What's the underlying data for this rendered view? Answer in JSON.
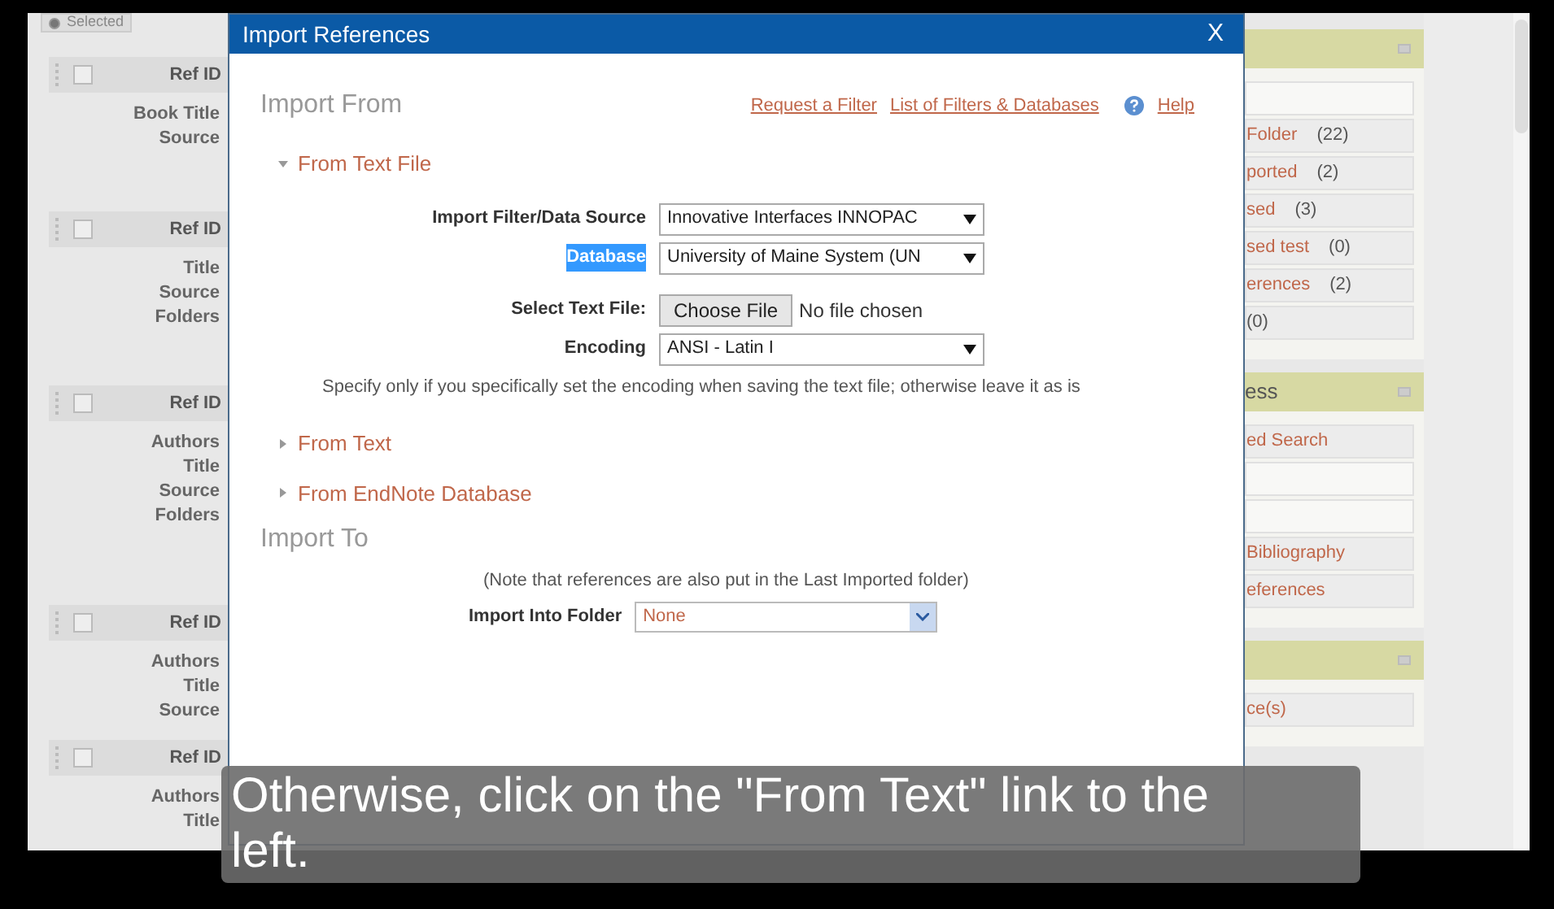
{
  "left_list": {
    "top_option": {
      "label": "Selected",
      "selected": true
    },
    "records": [
      {
        "checked": false,
        "header": "Ref ID",
        "fields": [
          "Book Title",
          "Source"
        ]
      },
      {
        "checked": false,
        "header": "Ref ID",
        "fields": [
          "Title",
          "Source",
          "Folders"
        ]
      },
      {
        "checked": false,
        "header": "Ref ID",
        "fields": [
          "Authors",
          "Title",
          "Source",
          "Folders"
        ]
      },
      {
        "checked": false,
        "header": "Ref ID",
        "fields": [
          "Authors",
          "Title",
          "Source"
        ]
      },
      {
        "checked": false,
        "header": "Ref ID",
        "fields": [
          "Authors",
          "Title"
        ]
      }
    ]
  },
  "dialog": {
    "title": "Import References",
    "close": "X",
    "import_from": {
      "heading": "Import From",
      "links": [
        "Request a Filter",
        "List of Filters & Databases"
      ],
      "help": "Help"
    },
    "sections": [
      {
        "label": "From Text File",
        "expanded": true
      },
      {
        "label": "From Text",
        "expanded": false
      },
      {
        "label": "From EndNote Database",
        "expanded": false
      }
    ],
    "form": {
      "rows": [
        {
          "kind": "select",
          "label": "Import Filter/Data Source",
          "value": "Innovative Interfaces INNOPAC",
          "selected": false
        },
        {
          "kind": "select",
          "label": "Database",
          "value": "University of Maine System (UN",
          "selected": true
        },
        {
          "kind": "file",
          "label": "Select Text File:",
          "button": "Choose File",
          "value": "No file chosen",
          "selected": false
        },
        {
          "kind": "select",
          "label": "Encoding",
          "value": "ANSI - Latin I",
          "selected": false
        }
      ],
      "hint": "Specify only if you specifically set the encoding when saving the text file; otherwise leave it as is"
    },
    "import_to": {
      "heading": "Import To",
      "note": "(Note that references are also put in the Last Imported folder)",
      "label": "Import Into Folder",
      "value": "None"
    }
  },
  "right_panel": {
    "sections": [
      {
        "items": [
          {
            "kind": "blank"
          },
          {
            "label": "Folder",
            "count": "(22)"
          },
          {
            "label": "ported",
            "count": "(2)"
          },
          {
            "label": "sed",
            "count": "(3)"
          },
          {
            "label": "sed test",
            "count": "(0)"
          },
          {
            "label": "erences",
            "count": "(2)"
          },
          {
            "count": "(0)"
          }
        ]
      },
      {
        "header": "ess",
        "items": [
          {
            "label": "ed Search"
          },
          {
            "kind": "blank"
          },
          {
            "kind": "blank"
          },
          {
            "label": "Bibliography"
          },
          {
            "label": "eferences"
          }
        ]
      },
      {
        "items": [
          {
            "label": "ce(s)"
          }
        ]
      }
    ]
  },
  "caption": "Otherwise, click on the \"From Text\" link to the left."
}
